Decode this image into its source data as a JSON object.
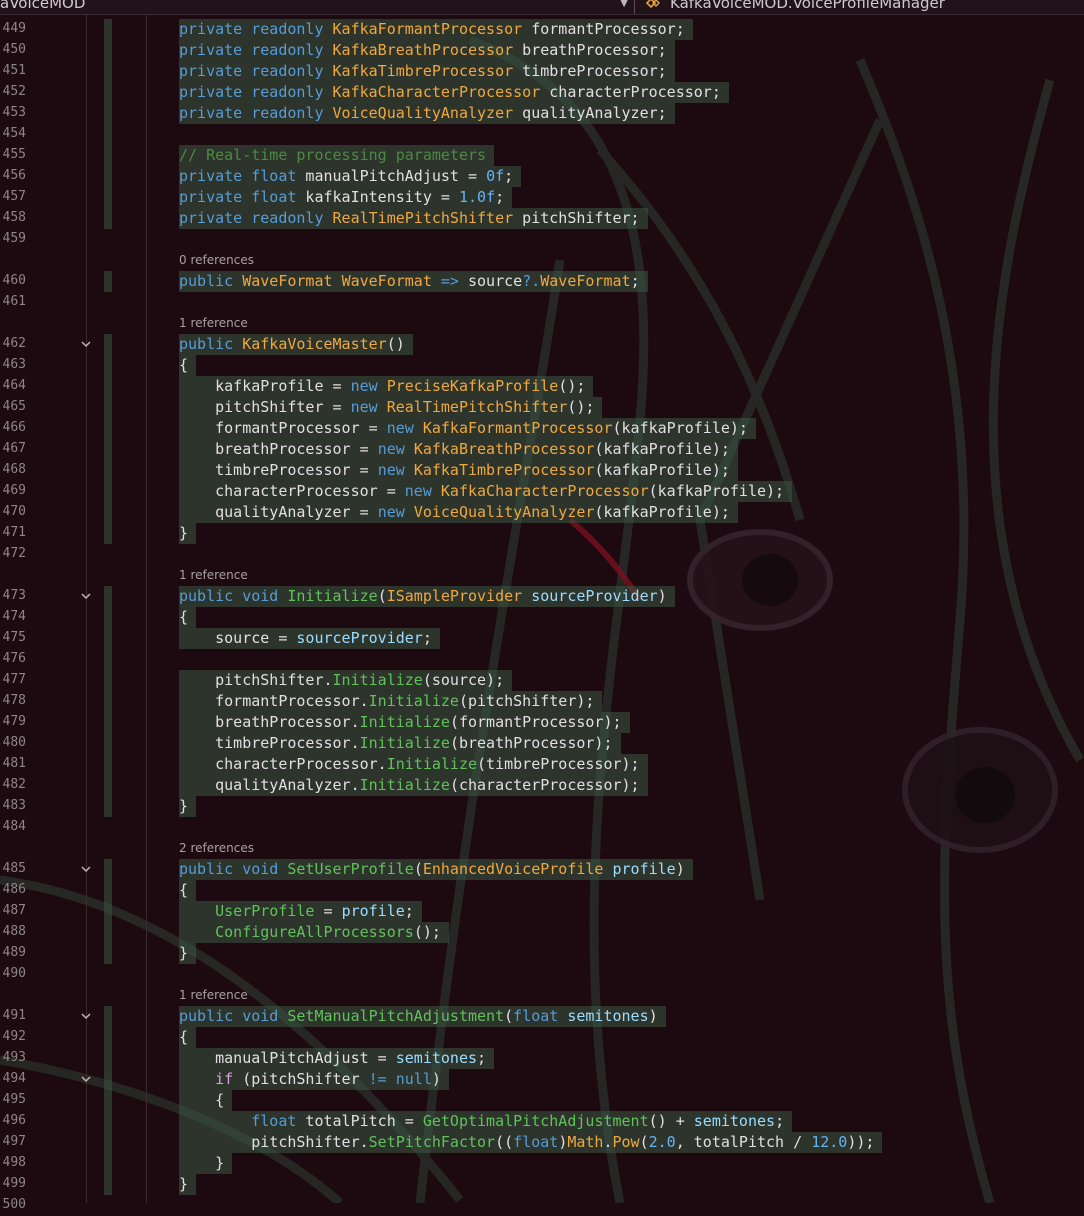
{
  "navbar": {
    "left_label": "aVoiceMOD",
    "right_label": "KafkaVoiceMOD.VoiceProfileManager"
  },
  "colors": {
    "background": "#1d0910",
    "keyword": "#569cd6",
    "type": "#f0a83c",
    "method": "#dcdcaa",
    "highlight": "#3a5844",
    "line_number": "#8e8589"
  },
  "code_lens": {
    "waveformat": "0 references",
    "constructor": "1 reference",
    "initialize": "1 reference",
    "set_user_profile": "2 references",
    "set_manual_pitch": "1 reference"
  },
  "lines": [
    {
      "n": "449",
      "tokens": [
        [
          "kw",
          "private"
        ],
        [
          "",
          "&nbsp;"
        ],
        [
          "kw",
          "readonly"
        ],
        [
          "",
          "&nbsp;"
        ],
        [
          "ty",
          "KafkaFormantProcessor"
        ],
        [
          "",
          "&nbsp;formantProcessor;"
        ]
      ],
      "hl": true
    },
    {
      "n": "450",
      "tokens": [
        [
          "kw",
          "private"
        ],
        [
          "",
          "&nbsp;"
        ],
        [
          "kw",
          "readonly"
        ],
        [
          "",
          "&nbsp;"
        ],
        [
          "ty",
          "KafkaBreathProcessor"
        ],
        [
          "",
          "&nbsp;breathProcessor;"
        ]
      ],
      "hl": true
    },
    {
      "n": "451",
      "tokens": [
        [
          "kw",
          "private"
        ],
        [
          "",
          "&nbsp;"
        ],
        [
          "kw",
          "readonly"
        ],
        [
          "",
          "&nbsp;"
        ],
        [
          "ty",
          "KafkaTimbreProcessor"
        ],
        [
          "",
          "&nbsp;timbreProcessor;"
        ]
      ],
      "hl": true
    },
    {
      "n": "452",
      "tokens": [
        [
          "kw",
          "private"
        ],
        [
          "",
          "&nbsp;"
        ],
        [
          "kw",
          "readonly"
        ],
        [
          "",
          "&nbsp;"
        ],
        [
          "ty",
          "KafkaCharacterProcessor"
        ],
        [
          "",
          "&nbsp;characterProcessor;"
        ]
      ],
      "hl": true
    },
    {
      "n": "453",
      "tokens": [
        [
          "kw",
          "private"
        ],
        [
          "",
          "&nbsp;"
        ],
        [
          "kw",
          "readonly"
        ],
        [
          "",
          "&nbsp;"
        ],
        [
          "ty",
          "VoiceQualityAnalyzer"
        ],
        [
          "",
          "&nbsp;qualityAnalyzer;"
        ]
      ],
      "hl": true
    },
    {
      "n": "454",
      "tokens": [],
      "hl": true
    },
    {
      "n": "455",
      "tokens": [
        [
          "cm",
          "// Real-time processing parameters"
        ]
      ],
      "hl": true
    },
    {
      "n": "456",
      "tokens": [
        [
          "kw",
          "private"
        ],
        [
          "",
          "&nbsp;"
        ],
        [
          "kw",
          "float"
        ],
        [
          "",
          "&nbsp;manualPitchAdjust = "
        ],
        [
          "nu",
          "0f"
        ],
        [
          "",
          ";"
        ]
      ],
      "hl": true
    },
    {
      "n": "457",
      "tokens": [
        [
          "kw",
          "private"
        ],
        [
          "",
          "&nbsp;"
        ],
        [
          "kw",
          "float"
        ],
        [
          "",
          "&nbsp;kafkaIntensity = "
        ],
        [
          "nu",
          "1.0f"
        ],
        [
          "",
          ";"
        ]
      ],
      "hl": true
    },
    {
      "n": "458",
      "tokens": [
        [
          "kw",
          "private"
        ],
        [
          "",
          "&nbsp;"
        ],
        [
          "kw",
          "readonly"
        ],
        [
          "",
          "&nbsp;"
        ],
        [
          "ty",
          "RealTimePitchShifter"
        ],
        [
          "",
          "&nbsp;pitchShifter;"
        ]
      ],
      "hl": true
    },
    {
      "n": "459",
      "tokens": [],
      "hl": false
    },
    {
      "lens": "waveformat"
    },
    {
      "n": "460",
      "tokens": [
        [
          "kw",
          "public"
        ],
        [
          "",
          "&nbsp;"
        ],
        [
          "ty",
          "WaveFormat"
        ],
        [
          "",
          "&nbsp;"
        ],
        [
          "ty",
          "WaveFormat"
        ],
        [
          "",
          "&nbsp;"
        ],
        [
          "kw",
          "=>"
        ],
        [
          "",
          "&nbsp;source"
        ],
        [
          "kw",
          "?."
        ],
        [
          "ty",
          "WaveFormat"
        ],
        [
          "",
          ";"
        ]
      ],
      "hl": true
    },
    {
      "n": "461",
      "tokens": [],
      "hl": false
    },
    {
      "lens": "constructor"
    },
    {
      "n": "462",
      "fold": true,
      "tokens": [
        [
          "kw",
          "public"
        ],
        [
          "",
          "&nbsp;"
        ],
        [
          "ty",
          "KafkaVoiceMaster"
        ],
        [
          "",
          "()"
        ]
      ],
      "hl": true
    },
    {
      "n": "463",
      "tokens": [
        [
          "",
          "{"
        ]
      ],
      "hl": true
    },
    {
      "n": "464",
      "tokens": [
        [
          "",
          "&nbsp;&nbsp;&nbsp;&nbsp;kafkaProfile = "
        ],
        [
          "kw",
          "new"
        ],
        [
          "",
          "&nbsp;"
        ],
        [
          "ty",
          "PreciseKafkaProfile"
        ],
        [
          "",
          "();"
        ]
      ],
      "hl": true
    },
    {
      "n": "465",
      "tokens": [
        [
          "",
          "&nbsp;&nbsp;&nbsp;&nbsp;pitchShifter = "
        ],
        [
          "kw",
          "new"
        ],
        [
          "",
          "&nbsp;"
        ],
        [
          "ty",
          "RealTimePitchShifter"
        ],
        [
          "",
          "();"
        ]
      ],
      "hl": true
    },
    {
      "n": "466",
      "tokens": [
        [
          "",
          "&nbsp;&nbsp;&nbsp;&nbsp;formantProcessor = "
        ],
        [
          "kw",
          "new"
        ],
        [
          "",
          "&nbsp;"
        ],
        [
          "ty",
          "KafkaFormantProcessor"
        ],
        [
          "",
          "(kafkaProfile);"
        ]
      ],
      "hl": true
    },
    {
      "n": "467",
      "tokens": [
        [
          "",
          "&nbsp;&nbsp;&nbsp;&nbsp;breathProcessor = "
        ],
        [
          "kw",
          "new"
        ],
        [
          "",
          "&nbsp;"
        ],
        [
          "ty",
          "KafkaBreathProcessor"
        ],
        [
          "",
          "(kafkaProfile);"
        ]
      ],
      "hl": true
    },
    {
      "n": "468",
      "tokens": [
        [
          "",
          "&nbsp;&nbsp;&nbsp;&nbsp;timbreProcessor = "
        ],
        [
          "kw",
          "new"
        ],
        [
          "",
          "&nbsp;"
        ],
        [
          "ty",
          "KafkaTimbreProcessor"
        ],
        [
          "",
          "(kafkaProfile);"
        ]
      ],
      "hl": true
    },
    {
      "n": "469",
      "tokens": [
        [
          "",
          "&nbsp;&nbsp;&nbsp;&nbsp;characterProcessor = "
        ],
        [
          "kw",
          "new"
        ],
        [
          "",
          "&nbsp;"
        ],
        [
          "ty",
          "KafkaCharacterProcessor"
        ],
        [
          "",
          "(kafkaProfile);"
        ]
      ],
      "hl": true
    },
    {
      "n": "470",
      "tokens": [
        [
          "",
          "&nbsp;&nbsp;&nbsp;&nbsp;qualityAnalyzer = "
        ],
        [
          "kw",
          "new"
        ],
        [
          "",
          "&nbsp;"
        ],
        [
          "ty",
          "VoiceQualityAnalyzer"
        ],
        [
          "",
          "(kafkaProfile);"
        ]
      ],
      "hl": true
    },
    {
      "n": "471",
      "tokens": [
        [
          "",
          "}"
        ]
      ],
      "hl": true
    },
    {
      "n": "472",
      "tokens": [],
      "hl": false
    },
    {
      "lens": "initialize"
    },
    {
      "n": "473",
      "fold": true,
      "tokens": [
        [
          "kw",
          "public"
        ],
        [
          "",
          "&nbsp;"
        ],
        [
          "kw",
          "void"
        ],
        [
          "",
          "&nbsp;"
        ],
        [
          "me",
          "Initialize"
        ],
        [
          "",
          "("
        ],
        [
          "ty",
          "ISampleProvider"
        ],
        [
          "",
          "&nbsp;"
        ],
        [
          "pa",
          "sourceProvider"
        ],
        [
          "",
          ")"
        ]
      ],
      "hl": true
    },
    {
      "n": "474",
      "tokens": [
        [
          "",
          "{"
        ]
      ],
      "hl": true
    },
    {
      "n": "475",
      "tokens": [
        [
          "",
          "&nbsp;&nbsp;&nbsp;&nbsp;source = "
        ],
        [
          "pa",
          "sourceProvider"
        ],
        [
          "",
          ";"
        ]
      ],
      "hl": true
    },
    {
      "n": "476",
      "tokens": [],
      "hl": true
    },
    {
      "n": "477",
      "tokens": [
        [
          "",
          "&nbsp;&nbsp;&nbsp;&nbsp;pitchShifter."
        ],
        [
          "me",
          "Initialize"
        ],
        [
          "",
          "(source);"
        ]
      ],
      "hl": true
    },
    {
      "n": "478",
      "tokens": [
        [
          "",
          "&nbsp;&nbsp;&nbsp;&nbsp;formantProcessor."
        ],
        [
          "me",
          "Initialize"
        ],
        [
          "",
          "(pitchShifter);"
        ]
      ],
      "hl": true
    },
    {
      "n": "479",
      "tokens": [
        [
          "",
          "&nbsp;&nbsp;&nbsp;&nbsp;breathProcessor."
        ],
        [
          "me",
          "Initialize"
        ],
        [
          "",
          "(formantProcessor);"
        ]
      ],
      "hl": true
    },
    {
      "n": "480",
      "tokens": [
        [
          "",
          "&nbsp;&nbsp;&nbsp;&nbsp;timbreProcessor."
        ],
        [
          "me",
          "Initialize"
        ],
        [
          "",
          "(breathProcessor);"
        ]
      ],
      "hl": true
    },
    {
      "n": "481",
      "tokens": [
        [
          "",
          "&nbsp;&nbsp;&nbsp;&nbsp;characterProcessor."
        ],
        [
          "me",
          "Initialize"
        ],
        [
          "",
          "(timbreProcessor);"
        ]
      ],
      "hl": true
    },
    {
      "n": "482",
      "tokens": [
        [
          "",
          "&nbsp;&nbsp;&nbsp;&nbsp;qualityAnalyzer."
        ],
        [
          "me",
          "Initialize"
        ],
        [
          "",
          "(characterProcessor);"
        ]
      ],
      "hl": true
    },
    {
      "n": "483",
      "tokens": [
        [
          "",
          "}"
        ]
      ],
      "hl": true
    },
    {
      "n": "484",
      "tokens": [],
      "hl": false
    },
    {
      "lens": "set_user_profile"
    },
    {
      "n": "485",
      "fold": true,
      "tokens": [
        [
          "kw",
          "public"
        ],
        [
          "",
          "&nbsp;"
        ],
        [
          "kw",
          "void"
        ],
        [
          "",
          "&nbsp;"
        ],
        [
          "me",
          "SetUserProfile"
        ],
        [
          "",
          "("
        ],
        [
          "ty",
          "EnhancedVoiceProfile"
        ],
        [
          "",
          "&nbsp;"
        ],
        [
          "pa",
          "profile"
        ],
        [
          "",
          ")"
        ]
      ],
      "hl": true
    },
    {
      "n": "486",
      "tokens": [
        [
          "",
          "{"
        ]
      ],
      "hl": true
    },
    {
      "n": "487",
      "tokens": [
        [
          "",
          "&nbsp;&nbsp;&nbsp;&nbsp;"
        ],
        [
          "me",
          "UserProfile"
        ],
        [
          "",
          ""
        ],
        [
          "",
          ""
        ],
        [
          "",
          "&nbsp;=&nbsp;"
        ],
        [
          "pa",
          "profile"
        ],
        [
          "",
          ";"
        ]
      ],
      "hl": true
    },
    {
      "n": "488",
      "tokens": [
        [
          "",
          "&nbsp;&nbsp;&nbsp;&nbsp;"
        ],
        [
          "me",
          "ConfigureAllProcessors"
        ],
        [
          "",
          "();"
        ]
      ],
      "hl": true
    },
    {
      "n": "489",
      "tokens": [
        [
          "",
          "}"
        ]
      ],
      "hl": true
    },
    {
      "n": "490",
      "tokens": [],
      "hl": false
    },
    {
      "lens": "set_manual_pitch"
    },
    {
      "n": "491",
      "fold": true,
      "tokens": [
        [
          "kw",
          "public"
        ],
        [
          "",
          "&nbsp;"
        ],
        [
          "kw",
          "void"
        ],
        [
          "",
          "&nbsp;"
        ],
        [
          "me",
          "SetManualPitchAdjustment"
        ],
        [
          "",
          "("
        ],
        [
          "kw",
          "float"
        ],
        [
          "",
          "&nbsp;"
        ],
        [
          "pa",
          "semitones"
        ],
        [
          "",
          ")"
        ]
      ],
      "hl": true
    },
    {
      "n": "492",
      "tokens": [
        [
          "",
          "{"
        ]
      ],
      "hl": true
    },
    {
      "n": "493",
      "tokens": [
        [
          "",
          "&nbsp;&nbsp;&nbsp;&nbsp;manualPitchAdjust = "
        ],
        [
          "pa",
          "semitones"
        ],
        [
          "",
          ";"
        ]
      ],
      "hl": true
    },
    {
      "n": "494",
      "fold": true,
      "tokens": [
        [
          "",
          "&nbsp;&nbsp;&nbsp;&nbsp;"
        ],
        [
          "kc",
          "if"
        ],
        [
          "",
          "&nbsp;(pitchShifter "
        ],
        [
          "kw",
          "!="
        ],
        [
          "",
          "&nbsp;"
        ],
        [
          "kw",
          "null"
        ],
        [
          "",
          ")"
        ]
      ],
      "hl": true
    },
    {
      "n": "495",
      "tokens": [
        [
          "",
          "&nbsp;&nbsp;&nbsp;&nbsp;{"
        ]
      ],
      "hl": true
    },
    {
      "n": "496",
      "tokens": [
        [
          "",
          "&nbsp;&nbsp;&nbsp;&nbsp;&nbsp;&nbsp;&nbsp;&nbsp;"
        ],
        [
          "kw",
          "float"
        ],
        [
          "",
          "&nbsp;totalPitch = "
        ],
        [
          "me",
          "GetOptimalPitchAdjustment"
        ],
        [
          "",
          "() + "
        ],
        [
          "pa",
          "semitones"
        ],
        [
          "",
          ";"
        ]
      ],
      "hl": true
    },
    {
      "n": "497",
      "tokens": [
        [
          "",
          "&nbsp;&nbsp;&nbsp;&nbsp;&nbsp;&nbsp;&nbsp;&nbsp;pitchShifter."
        ],
        [
          "me",
          "SetPitchFactor"
        ],
        [
          "",
          "(("
        ],
        [
          "kw",
          "float"
        ],
        [
          "",
          ")"
        ],
        [
          "ty",
          "Math"
        ],
        [
          "",
          "."
        ],
        [
          "ty",
          "Pow"
        ],
        [
          "",
          "("
        ],
        [
          "nu",
          "2.0"
        ],
        [
          "",
          ", totalPitch / "
        ],
        [
          "nu",
          "12.0"
        ],
        [
          "",
          "));"
        ]
      ],
      "hl": true
    },
    {
      "n": "498",
      "tokens": [
        [
          "",
          "&nbsp;&nbsp;&nbsp;&nbsp;}"
        ]
      ],
      "hl": true
    },
    {
      "n": "499",
      "tokens": [
        [
          "",
          "}"
        ]
      ],
      "hl": true
    },
    {
      "n": "500",
      "tokens": [],
      "hl": false
    }
  ]
}
